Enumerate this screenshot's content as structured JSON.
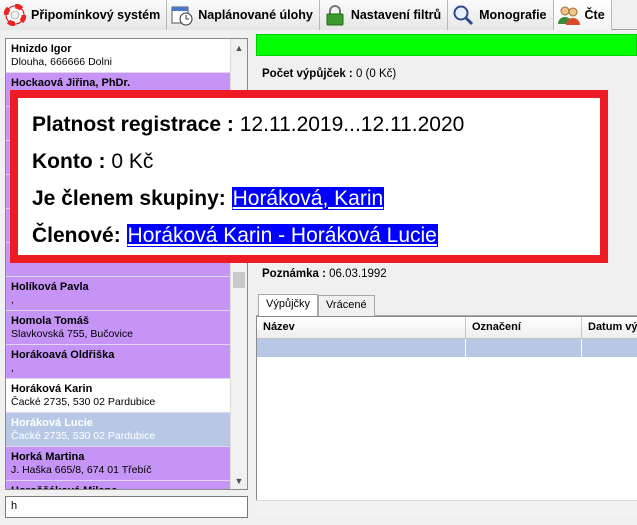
{
  "tabs": [
    {
      "label": "Připomínkový systém",
      "icon": "lifebuoy-icon"
    },
    {
      "label": "Naplánované úlohy",
      "icon": "calendar-clock-icon"
    },
    {
      "label": "Nastavení filtrů",
      "icon": "lock-icon"
    },
    {
      "label": "Monografie",
      "icon": "search-icon"
    },
    {
      "label": "Čte",
      "icon": "users-icon"
    }
  ],
  "readers": [
    {
      "name": "Hnizdo Igor",
      "address": "Dlouha, 666666 Dolni",
      "style": "white"
    },
    {
      "name": "Hockaová Jiřina, PhDr.",
      "address": "",
      "style": "purple"
    },
    {
      "name": "",
      "address": "",
      "style": "purple"
    },
    {
      "name": "",
      "address": "",
      "style": "purple"
    },
    {
      "name": "",
      "address": "",
      "style": "purple"
    },
    {
      "name": "",
      "address": "",
      "style": "purple"
    },
    {
      "name": "",
      "address": "",
      "style": "purple"
    },
    {
      "name": "Holíková Pavla",
      "address": ",",
      "style": "purple"
    },
    {
      "name": "Homola Tomáš",
      "address": "Slavkovská 755,  Bučovice",
      "style": "purple"
    },
    {
      "name": "Horákoavá Oldřiška",
      "address": ",",
      "style": "purple"
    },
    {
      "name": "Horáková Karin",
      "address": "Čacké 2735, 530 02 Pardubice",
      "style": "white"
    },
    {
      "name": "Horáková Lucie",
      "address": "Čacké 2735, 530 02 Pardubice",
      "style": "sel"
    },
    {
      "name": "Horká Martina",
      "address": "J. Haška 665/8, 674 01 Třebíč",
      "style": "purple"
    },
    {
      "name": "Horoščáková Milana",
      "address": "",
      "style": "purple"
    }
  ],
  "search": {
    "value": "h"
  },
  "detail": {
    "loans_label": "Počet výpůjček :",
    "loans_value": "0 (0 Kč)",
    "note_label": "Poznámka :",
    "note_value": "06.03.1992"
  },
  "subtabs": [
    "Výpůjčky",
    "Vrácené"
  ],
  "grid_columns": [
    "Název",
    "Označení",
    "Datum výp"
  ],
  "overlay": {
    "reg_label": "Platnost registrace :",
    "reg_value": "12.11.2019...12.11.2020",
    "account_label": "Konto :",
    "account_value": "0 Kč",
    "group_label": "Je členem skupiny:",
    "group_value": "Horáková, Karin",
    "members_label": "Členové:",
    "members_value": "Horáková Karin - Horáková Lucie"
  },
  "colors": {
    "highlight": "#ed1c24",
    "member": "#c594f6",
    "selection": "#b6c8e6",
    "status_ok": "#00ff00",
    "link_bg": "#0000ff"
  }
}
